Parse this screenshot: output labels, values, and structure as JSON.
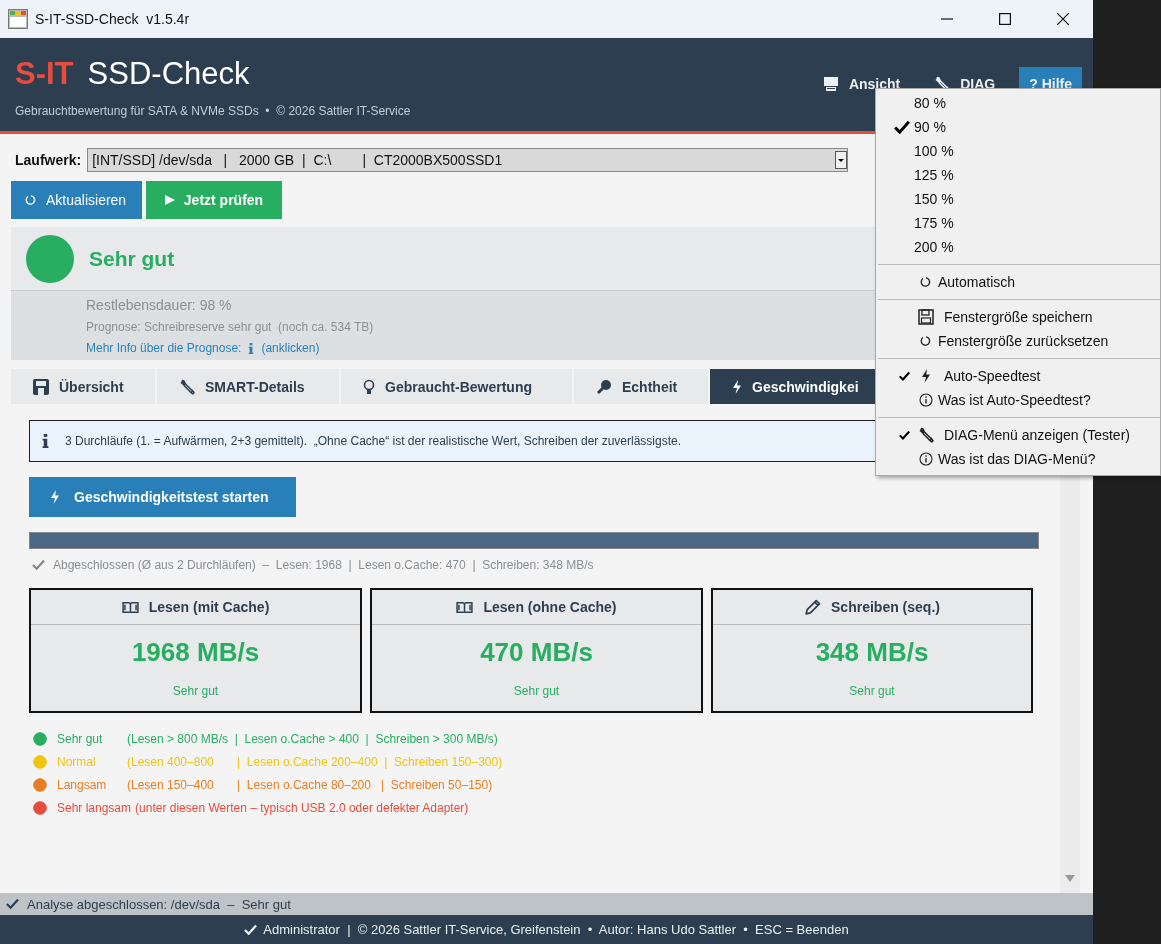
{
  "window": {
    "title": "S-IT-SSD-Check  v1.5.4r"
  },
  "header": {
    "brand": "S-IT",
    "product": "SSD-Check",
    "subtitle": "Gebrauchtbewertung für SATA & NVMe SSDs  •  © 2026 Sattler IT-Service",
    "menus": [
      {
        "label": "Ansicht",
        "active": false
      },
      {
        "label": "DIAG",
        "active": false
      },
      {
        "label": "? Hilfe",
        "active": true
      }
    ]
  },
  "drive": {
    "label": "Laufwerk:",
    "value": "[INT/SSD] /dev/sda   |   2000 GB  |  C:\\        |  CT2000BX500SSD1"
  },
  "buttons": [
    {
      "label": "Aktualisieren",
      "kind": "refresh"
    },
    {
      "label": "Jetzt prüfen",
      "kind": "run"
    }
  ],
  "status": {
    "color": "#27ae60",
    "title": "Sehr gut",
    "life": "Restlebensdauer: 98 %",
    "forecast": "Prognose: Schreibreserve sehr gut  (noch ca. 534 TB)",
    "link": "Mehr Info über die Prognose:",
    "link_hint": "(anklicken)"
  },
  "tabs": [
    {
      "label": "Übersicht",
      "selected": false
    },
    {
      "label": "SMART-Details",
      "selected": false
    },
    {
      "label": "Gebraucht-Bewertung",
      "selected": false
    },
    {
      "label": "Echtheit",
      "selected": false
    },
    {
      "label": "Geschwindigkei",
      "selected": true
    }
  ],
  "speed": {
    "info": "3 Durchläufe (1. = Aufwärmen, 2+3 gemittelt).  „Ohne Cache“ ist der realistische Wert, Schreiben der zuverlässigste.",
    "start_button": "Geschwindigkeitstest starten",
    "level": 1,
    "result": "Abgeschlossen (Ø aus 2 Durchläufen)  –  Lesen: 1968  |  Lesen o.Cache: 470  |  Schreiben: 348 MB/s",
    "cards": [
      {
        "title": "Lesen (mit Cache)",
        "value": "1968 MB/s",
        "rating": "Sehr gut"
      },
      {
        "title": "Lesen (ohne Cache)",
        "value": "470 MB/s",
        "rating": "Sehr gut"
      },
      {
        "title": "Schreiben (seq.)",
        "value": "348 MB/s",
        "rating": "Sehr gut"
      }
    ],
    "legend": [
      {
        "label": "Sehr gut",
        "detail": "(Lesen > 800 MB/s  |  Lesen o.Cache > 400  |  Schreiben > 300 MB/s)",
        "color": "#27ae60"
      },
      {
        "label": "Normal",
        "detail": "(Lesen 400–800       |  Lesen o.Cache 200–400  |  Schreiben 150–300)",
        "color": "#f1c40f"
      },
      {
        "label": "Langsam",
        "detail": "(Lesen 150–400       |  Lesen o.Cache 80–200   |  Schreiben 50–150)",
        "color": "#e67e22"
      },
      {
        "label": "Sehr langsam",
        "detail": "(unter diesen Werten – typisch USB 2.0 oder defekter Adapter)",
        "color": "#e74c3c"
      }
    ]
  },
  "status_bar": "Analyse abgeschlossen: /dev/sda  –  Sehr gut",
  "footer": "Administrator  |  © 2026 Sattler IT-Service, Greifenstein  •  Autor: Hans Udo Sattler  •  ESC = Beenden",
  "menu": {
    "groups": [
      [
        {
          "kind": "plain",
          "label": "80 %",
          "checked": false
        },
        {
          "kind": "plain",
          "label": "90 %",
          "checked": true
        },
        {
          "kind": "plain",
          "label": "100 %",
          "checked": false
        },
        {
          "kind": "plain",
          "label": "125 %",
          "checked": false
        },
        {
          "kind": "plain",
          "label": "150 %",
          "checked": false
        },
        {
          "kind": "plain",
          "label": "175 %",
          "checked": false
        },
        {
          "kind": "plain",
          "label": "200 %",
          "checked": false
        }
      ],
      [
        {
          "kind": "refresh",
          "label": "Automatisch",
          "checked": false
        }
      ],
      [
        {
          "kind": "save",
          "label": "Fenstergröße speichern",
          "checked": false
        },
        {
          "kind": "refresh",
          "label": "Fenstergröße zurücksetzen",
          "checked": false
        }
      ],
      [
        {
          "kind": "bolt",
          "label": "Auto-Speedtest",
          "checked": true
        },
        {
          "kind": "info",
          "label": "Was ist Auto-Speedtest?",
          "checked": false
        }
      ],
      [
        {
          "kind": "wrench",
          "label": "DIAG-Menü anzeigen (Tester)",
          "checked": true
        },
        {
          "kind": "info",
          "label": "Was ist das DIAG-Menü?",
          "checked": false
        }
      ]
    ]
  }
}
